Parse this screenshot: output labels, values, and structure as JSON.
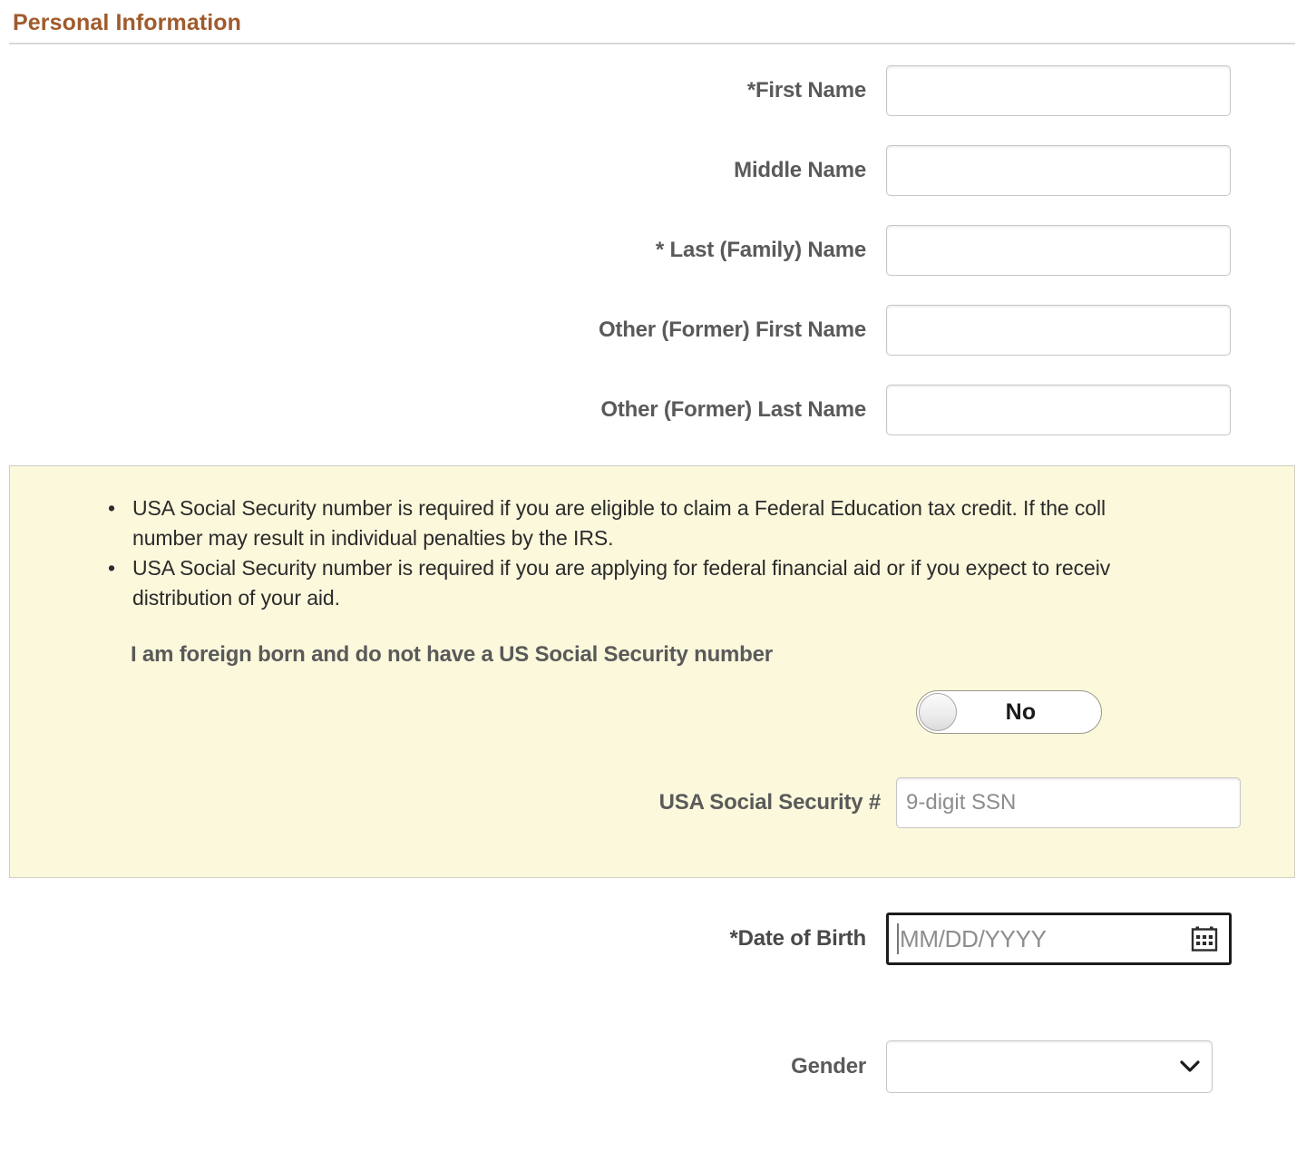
{
  "section": {
    "title": "Personal Information"
  },
  "fields": {
    "first_name": {
      "label": "*First Name",
      "value": "",
      "placeholder": ""
    },
    "middle_name": {
      "label": "Middle Name",
      "value": "",
      "placeholder": ""
    },
    "last_name": {
      "label": "* Last (Family) Name",
      "value": "",
      "placeholder": ""
    },
    "other_first_name": {
      "label": "Other (Former) First Name",
      "value": "",
      "placeholder": ""
    },
    "other_last_name": {
      "label": "Other (Former) Last Name",
      "value": "",
      "placeholder": ""
    },
    "ssn": {
      "label": "USA Social Security #",
      "value": "",
      "placeholder": "9-digit SSN"
    },
    "date_of_birth": {
      "label": "*Date of Birth",
      "value": "",
      "placeholder": "MM/DD/YYYY"
    },
    "gender": {
      "label": "Gender",
      "value": "",
      "selected_option": ""
    }
  },
  "info_panel": {
    "bullets": [
      {
        "line1": "USA Social Security number is required if you are eligible to claim a Federal Education tax credit. If the coll",
        "line2": "number may result in individual penalties by the IRS."
      },
      {
        "line1": "USA Social Security number is required if you are applying for federal financial aid or if you expect to receiv",
        "line2": "distribution of your aid."
      }
    ],
    "statement": "I am foreign born and do not have a US Social Security number",
    "toggle": {
      "label": "No",
      "state": "off"
    },
    "background_color": "#fbf8dc"
  },
  "icons": {
    "calendar": "calendar-icon",
    "chevron_down": "chevron-down-icon"
  },
  "colors": {
    "title": "#a05a2c",
    "label": "#5a5a5a",
    "panel_bg": "#fbf8dc",
    "focus_border": "#1c1c1c"
  }
}
